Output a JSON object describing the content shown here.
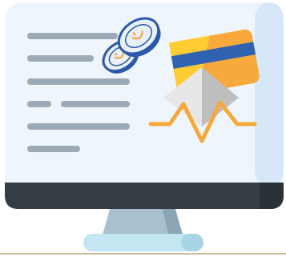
{
  "illustration": {
    "subject": "monitor-with-coins-and-card",
    "icons": {
      "monitor": "monitor-icon",
      "coins": "coins-icon",
      "card": "credit-card-icon",
      "pulse": "pulse-line-icon"
    },
    "colors": {
      "monitor_face": "#EEF5FC",
      "monitor_shade": "#D6E8F7",
      "bezel": "#353D44",
      "bezel_dark": "#2A3137",
      "stand": "#A9C1CF",
      "stand_dark": "#8AA6B4",
      "base": "#C3E6F2",
      "floor_line": "#C8C0A0",
      "text_lines": "#9DA9B4",
      "coin_fill": "#E9F0FA",
      "coin_stroke": "#2B58A8",
      "coin_face": "#F6A93B",
      "card_orange": "#F8A93B",
      "card_yellow": "#FFCC33",
      "card_stripe": "#2F63B1",
      "pyramid_light": "#E7E7E7",
      "pyramid_dark": "#BEBEBE",
      "pulse": "#F6A93B"
    }
  }
}
